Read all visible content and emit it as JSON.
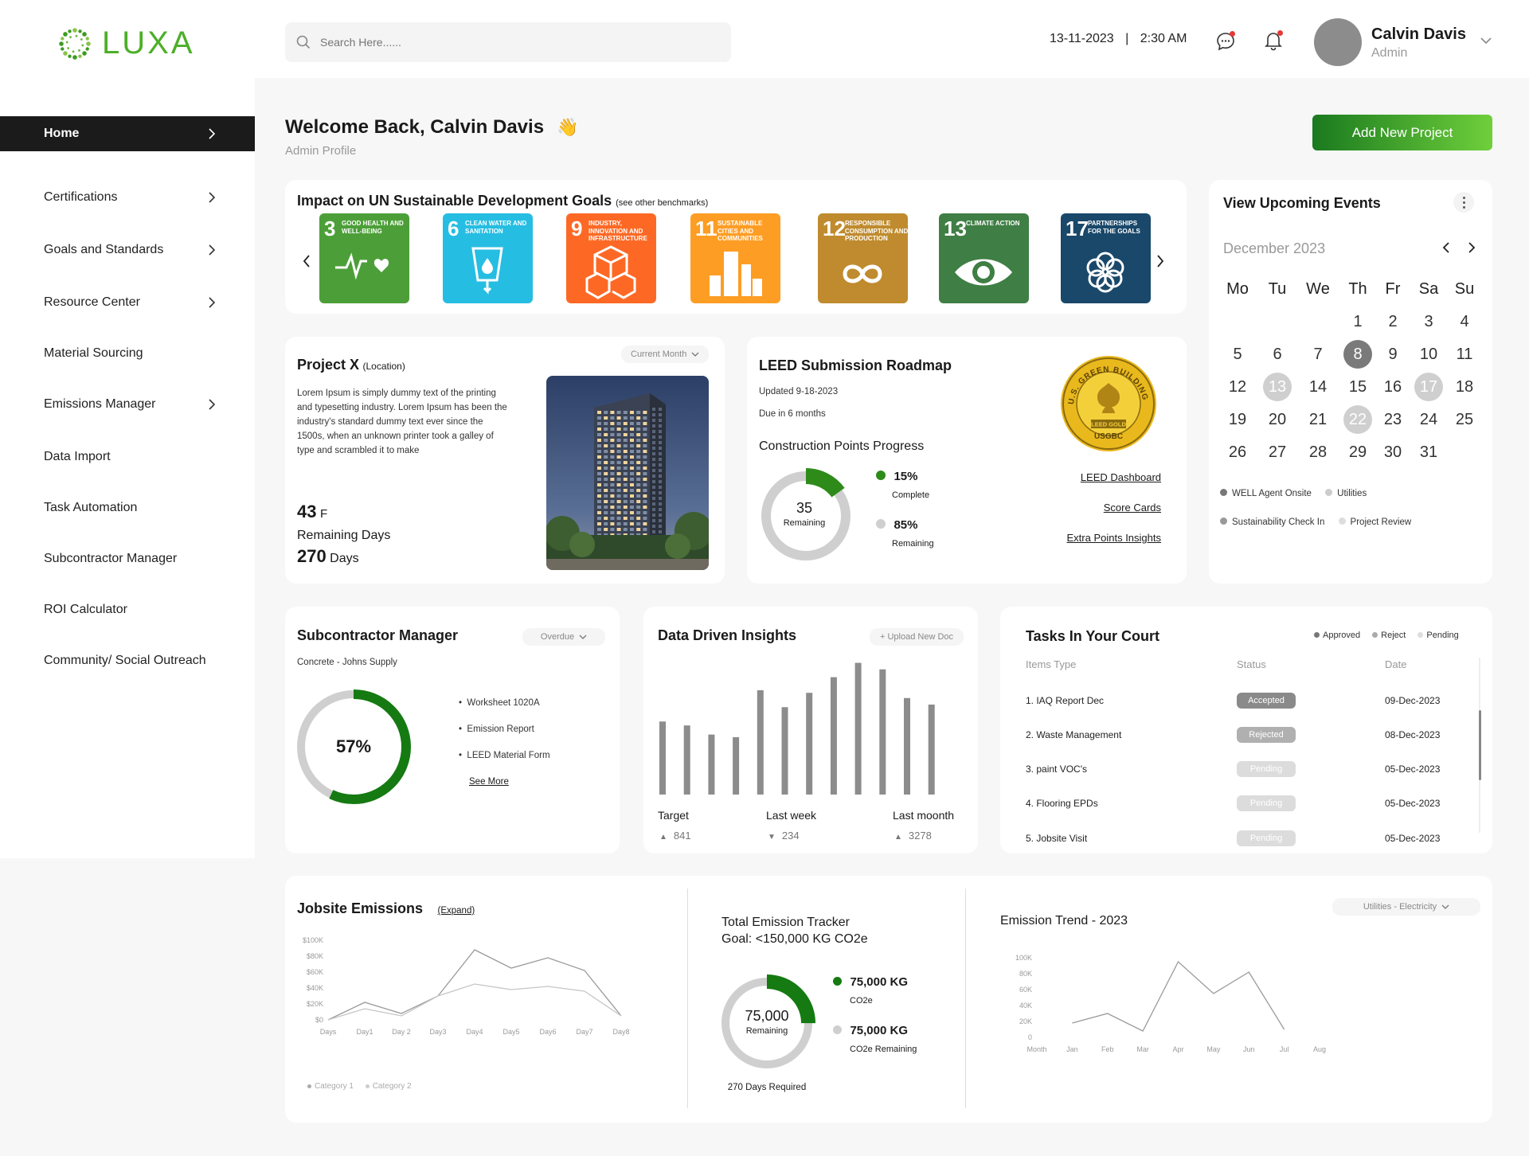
{
  "brand": {
    "name": "LUXA"
  },
  "search": {
    "placeholder": "Search Here......"
  },
  "header": {
    "date": "13-11-2023",
    "separator": "|",
    "time": "2:30 AM",
    "user_name": "Calvin Davis",
    "user_role": "Admin"
  },
  "sidebar": {
    "items": [
      {
        "label": "Home",
        "has_chevron": true
      },
      {
        "label": "Certifications",
        "has_chevron": true
      },
      {
        "label": "Goals and Standards",
        "has_chevron": true
      },
      {
        "label": "Resource Center",
        "has_chevron": true
      },
      {
        "label": "Material Sourcing",
        "has_chevron": false
      },
      {
        "label": "Emissions Manager",
        "has_chevron": true
      },
      {
        "label": "Data Import",
        "has_chevron": false
      },
      {
        "label": "Task Automation",
        "has_chevron": false
      },
      {
        "label": "Subcontractor Manager",
        "has_chevron": false
      },
      {
        "label": "ROI Calculator",
        "has_chevron": false
      },
      {
        "label": "Community/ Social Outreach",
        "has_chevron": false
      }
    ]
  },
  "welcome": {
    "title": "Welcome Back, Calvin Davis",
    "emoji": "👋",
    "subtitle": "Admin Profile",
    "cta": "Add New Project"
  },
  "sdg": {
    "title": "Impact on UN Sustainable Development Goals",
    "title_note": "(see other benchmarks)",
    "goals": [
      {
        "num": "3",
        "label": "Good Health and Well-Being",
        "color": "#4c9f38"
      },
      {
        "num": "6",
        "label": "Clean Water and Sanitation",
        "color": "#26bde2"
      },
      {
        "num": "9",
        "label": "Industry, Innovation and Infrastructure",
        "color": "#fd6925"
      },
      {
        "num": "11",
        "label": "Sustainable Cities and Communities",
        "color": "#fd9d24"
      },
      {
        "num": "12",
        "label": "Responsible Consumption and Production",
        "color": "#bf8b2e"
      },
      {
        "num": "13",
        "label": "Climate Action",
        "color": "#3f7e44"
      },
      {
        "num": "17",
        "label": "Partnerships for the Goals",
        "color": "#19486a"
      }
    ]
  },
  "project": {
    "title": "Project X",
    "location": "(Location)",
    "filter": "Current Month",
    "description": "Lorem Ipsum is simply dummy text of the printing and typesetting industry. Lorem Ipsum has been the industry's standard dummy text ever since the 1500s, when an unknown printer took a galley of type and scrambled it to make",
    "temp": "43",
    "temp_unit": "F",
    "remaining_label": "Remaining Days",
    "days": "270",
    "days_unit": "Days"
  },
  "leed": {
    "title": "LEED Submission Roadmap",
    "updated": "Updated 9-18-2023",
    "due": "Due in 6 months",
    "progress_title": "Construction Points Progress",
    "center_value": "35",
    "center_label": "Remaining",
    "complete_pct": "15%",
    "complete_label": "Complete",
    "remaining_pct": "85%",
    "remaining_label": "Remaining",
    "complete_fraction": 0.15,
    "links": [
      "LEED Dashboard",
      "Score Cards",
      "Extra Points Insights"
    ],
    "badge_text": "U.S. GREEN BUILDING COUNCIL",
    "badge_gold": "LEED GOLD",
    "badge_usgbc": "USGBC"
  },
  "events": {
    "title": "View Upcoming Events",
    "month": "December 2023",
    "weekdays": [
      "Mo",
      "Tu",
      "We",
      "Th",
      "Fr",
      "Sa",
      "Su"
    ],
    "start_offset": 3,
    "days_in_month": 31,
    "highlight_dark": [
      8
    ],
    "highlight_light": [
      13,
      17,
      22
    ],
    "legend": [
      "WELL Agent Onsite",
      "Utilities",
      "Sustainability Check In",
      "Project Review"
    ]
  },
  "subcontractor": {
    "title": "Subcontractor Manager",
    "filter": "Overdue",
    "subtitle": "Concrete - Johns Supply",
    "pct": "57%",
    "fraction": 0.57,
    "items": [
      "Worksheet 1020A",
      "Emission Report",
      "LEED Material Form"
    ],
    "see_more": "See More"
  },
  "insights": {
    "title": "Data Driven Insights",
    "upload": "+ Upload New Doc",
    "stats": [
      {
        "label": "Target",
        "dir": "up",
        "value": "841"
      },
      {
        "label": "Last week",
        "dir": "down",
        "value": "234"
      },
      {
        "label": "Last moonth",
        "dir": "up",
        "value": "3278"
      }
    ]
  },
  "tasks": {
    "title": "Tasks In Your Court",
    "legend": [
      "Approved",
      "Reject",
      "Pending"
    ],
    "columns": [
      "Items Type",
      "Status",
      "Date"
    ],
    "rows": [
      {
        "item": "1.   IAQ Report Dec",
        "status": "Accepted",
        "date": "09-Dec-2023",
        "color": "#8a8a8a"
      },
      {
        "item": "2.   Waste Management",
        "status": "Rejected",
        "date": "08-Dec-2023",
        "color": "#b0b0b0"
      },
      {
        "item": "3.   paint VOC's",
        "status": "Pending",
        "date": "05-Dec-2023",
        "color": "#dcdcdc"
      },
      {
        "item": "4.   Flooring EPDs",
        "status": "Pending",
        "date": "05-Dec-2023",
        "color": "#dcdcdc"
      },
      {
        "item": "5.   Jobsite Visit",
        "status": "Pending",
        "date": "05-Dec-2023",
        "color": "#dcdcdc"
      }
    ]
  },
  "jobsite": {
    "title": "Jobsite Emissions",
    "expand": "(Expand)"
  },
  "tracker": {
    "title": "Total Emission Tracker",
    "goal": "Goal: <150,000 KG CO2e",
    "center_value": "75,000",
    "center_label": "Remaining",
    "val1": "75,000 KG",
    "lbl1": "CO2e",
    "val2": "75,000 KG",
    "lbl2": "CO2e Remaining",
    "footer": "270 Days Required",
    "fraction": 0.25
  },
  "trend": {
    "title": "Emission Trend - 2023",
    "filter": "Utilities - Electricity"
  },
  "chart_data": [
    {
      "type": "bar",
      "title": "Data Driven Insights",
      "categories": [
        "1",
        "2",
        "3",
        "4",
        "5",
        "6",
        "7",
        "8",
        "9",
        "10",
        "11",
        "12"
      ],
      "values": [
        56,
        53,
        46,
        44,
        80,
        67,
        78,
        90,
        101,
        96,
        74,
        69
      ],
      "ylim": [
        0,
        105
      ]
    },
    {
      "type": "line",
      "title": "Jobsite Emissions",
      "x": [
        "Days",
        "Day1",
        "Day 2",
        "Day3",
        "Day4",
        "Day5",
        "Day6",
        "Day7",
        "Day8"
      ],
      "yticks": [
        "$0",
        "$20K",
        "$40K",
        "$60K",
        "$80K",
        "$100K"
      ],
      "ylim": [
        0,
        100000
      ],
      "series": [
        {
          "name": "Category 1",
          "values": [
            0,
            22000,
            8000,
            30000,
            88000,
            65000,
            78000,
            62000,
            5000
          ]
        },
        {
          "name": "Category 2",
          "values": [
            0,
            14000,
            5000,
            30000,
            45000,
            38000,
            42000,
            36000,
            5000
          ]
        }
      ],
      "legend": "bottom-left"
    },
    {
      "type": "line",
      "title": "Emission Trend - 2023",
      "x": [
        "Month",
        "Jan",
        "Feb",
        "Mar",
        "Apr",
        "May",
        "Jun",
        "Jul",
        "Aug"
      ],
      "yticks": [
        "0",
        "20K",
        "40K",
        "60K",
        "80K",
        "100K"
      ],
      "ylim": [
        0,
        100000
      ],
      "series": [
        {
          "values": [
            null,
            18000,
            30000,
            8000,
            95000,
            55000,
            82000,
            10000
          ]
        }
      ]
    }
  ]
}
